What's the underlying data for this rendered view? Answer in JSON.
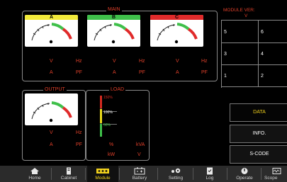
{
  "main_panel": {
    "title": "MAIN",
    "phases": [
      {
        "label": "A",
        "color": "#f2ea3a",
        "v_label": "V",
        "hz_label": "Hz",
        "a_label": "A",
        "pf_label": "PF"
      },
      {
        "label": "B",
        "color": "#3fc04a",
        "v_label": "V",
        "hz_label": "Hz",
        "a_label": "A",
        "pf_label": "PF"
      },
      {
        "label": "C",
        "color": "#e02a2a",
        "v_label": "V",
        "hz_label": "Hz",
        "a_label": "A",
        "pf_label": "PF"
      }
    ]
  },
  "output_panel": {
    "title": "OUTPUT",
    "v_label": "V",
    "hz_label": "Hz",
    "a_label": "A",
    "pf_label": "PF"
  },
  "load_panel": {
    "title": "LOAD",
    "scale": [
      "150%",
      "100%",
      "50%"
    ],
    "percent_label": "%",
    "kva_label": "kVA",
    "kw_label": "kW",
    "v_label": "V"
  },
  "module_ver": {
    "title": "MODULE VER:",
    "subtitle": "V",
    "cells": [
      "5",
      "6",
      "3",
      "4",
      "1",
      "2"
    ]
  },
  "side_buttons": {
    "data": "DATA",
    "info": "INFO.",
    "scode": "S-CODE"
  },
  "nav": {
    "tabs": [
      {
        "label": "Home",
        "icon": "home-icon"
      },
      {
        "label": "Cabinet",
        "icon": "cabinet-icon"
      },
      {
        "label": "Module",
        "icon": "module-icon",
        "active": true
      },
      {
        "label": "Battery",
        "icon": "battery-icon"
      },
      {
        "label": "Setting",
        "icon": "gear-icon"
      },
      {
        "label": "Log",
        "icon": "log-icon"
      },
      {
        "label": "Operate",
        "icon": "power-icon"
      },
      {
        "label": "Scope",
        "icon": "scope-icon"
      }
    ]
  },
  "colors": {
    "accent": "#e0402a",
    "active": "#f2d21c"
  }
}
